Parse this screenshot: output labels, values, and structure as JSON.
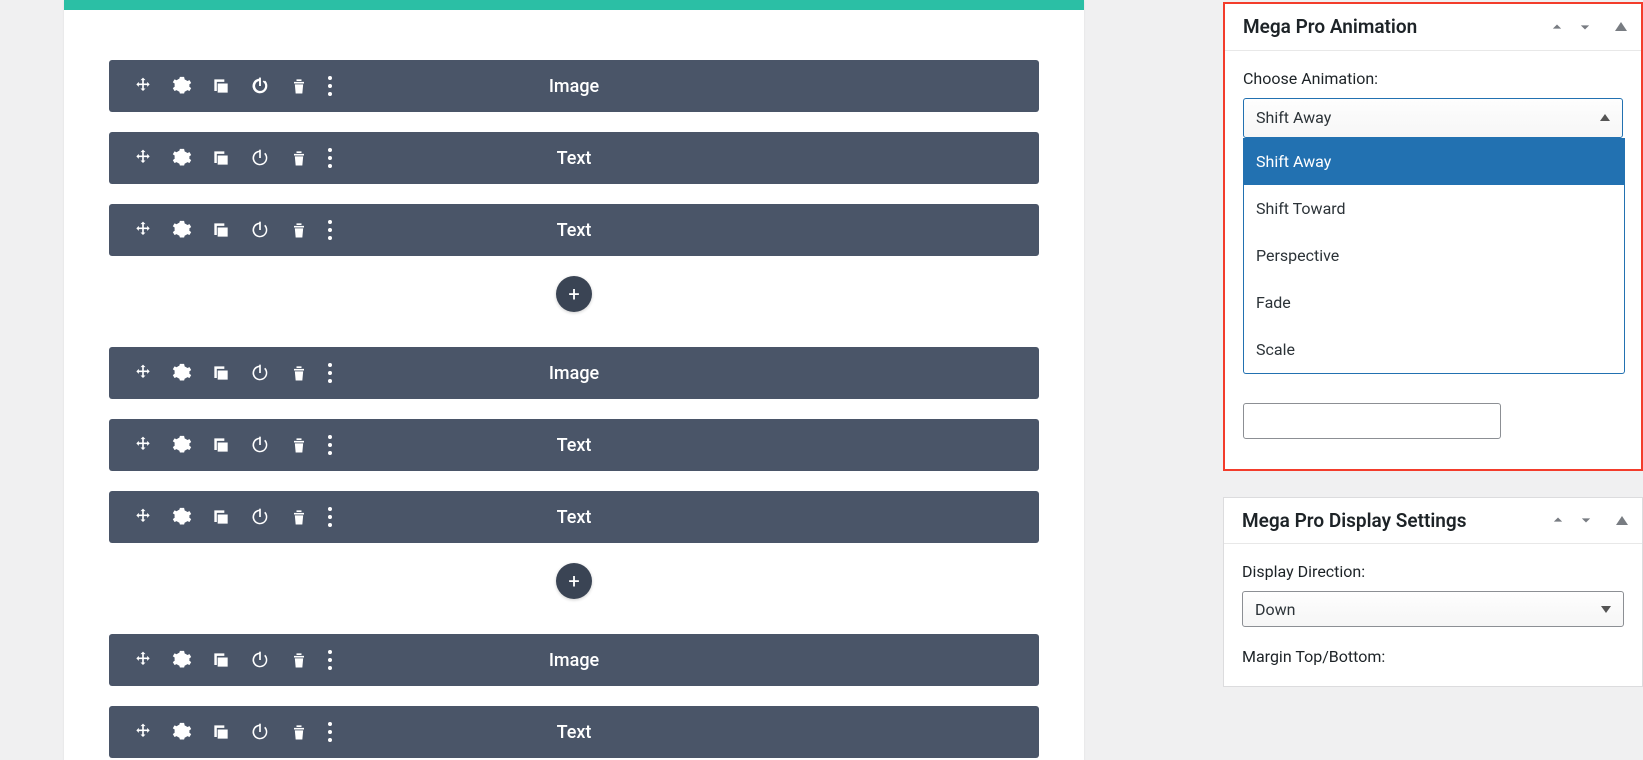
{
  "blocks": {
    "group1": [
      "Image",
      "Text",
      "Text"
    ],
    "group2": [
      "Image",
      "Text",
      "Text"
    ],
    "group3": [
      "Image",
      "Text"
    ]
  },
  "sidebar": {
    "animation_panel": {
      "title": "Mega Pro Animation",
      "field_label": "Choose Animation:",
      "selected": "Shift Away",
      "options": [
        "Shift Away",
        "Shift Toward",
        "Perspective",
        "Fade",
        "Scale"
      ]
    },
    "display_panel": {
      "title": "Mega Pro Display Settings",
      "direction_label": "Display Direction:",
      "direction_value": "Down",
      "margin_label": "Margin Top/Bottom:"
    }
  }
}
